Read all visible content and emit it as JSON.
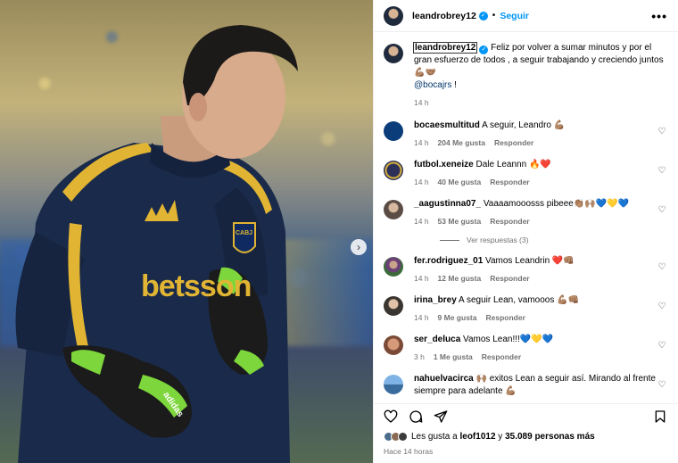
{
  "post": {
    "owner": "leandrobrey12",
    "follow_label": "Seguir",
    "more_label": "•••",
    "caption_user": "leandrobrey12",
    "caption_text": " Feliz por volver a sumar minutos y por el gran esfuerzo de todos , a seguir trabajando y creciendo juntos 💪🏽🤝🏽",
    "caption_mention": "@bocajrs",
    "caption_tail": " !",
    "caption_time": "14 h"
  },
  "media": {
    "next_label": "›",
    "jersey_sponsor": "betsson",
    "crest_text": "CABJ",
    "brand_text": "adidas"
  },
  "comments": [
    {
      "user": "bocaesmultitud",
      "text": "A seguir, Leandro 💪🏽",
      "time": "14 h",
      "likes": "204 Me gusta",
      "reply": "Responder"
    },
    {
      "user": "futbol.xeneize",
      "text": "Dale Leannn 🔥❤️",
      "time": "14 h",
      "likes": "40 Me gusta",
      "reply": "Responder"
    },
    {
      "user": "_aagustinna07_",
      "text": "Vaaaamooosss pibeee👏🏽🙌🏽💙💛💙",
      "time": "14 h",
      "likes": "53 Me gusta",
      "reply": "Responder",
      "view_replies": "Ver respuestas (3)"
    },
    {
      "user": "fer.rodriguez_01",
      "text": "Vamos Leandrin ❤️👊🏽",
      "time": "14 h",
      "likes": "12 Me gusta",
      "reply": "Responder"
    },
    {
      "user": "irina_brey",
      "text": "A seguir Lean, vamooos 💪🏽👊🏽",
      "time": "14 h",
      "likes": "9 Me gusta",
      "reply": "Responder"
    },
    {
      "user": "ser_deluca",
      "text": "Vamos Lean!!!💙💛💙",
      "time": "3 h",
      "likes": "1 Me gusta",
      "reply": "Responder"
    },
    {
      "user": "nahuelvacirca",
      "text": "🙌🏽 exitos Lean a seguir así. Mirando al frente siempre para adelante 💪🏽",
      "time": "",
      "likes": "",
      "reply": ""
    }
  ],
  "footer": {
    "likes_prefix": "Les gusta a ",
    "likes_user": "leof1012",
    "likes_middle": " y ",
    "likes_count": "35.089 personas más",
    "time_ago": "Hace 14 horas"
  },
  "colors": {
    "accent": "#0095f6",
    "muted": "#737373",
    "jersey": "#1a2a4a",
    "gold": "#f2c230"
  }
}
